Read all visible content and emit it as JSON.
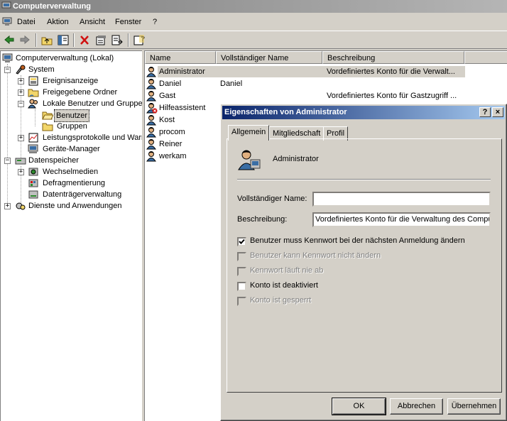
{
  "window": {
    "title": "Computerverwaltung"
  },
  "menu": [
    "Datei",
    "Aktion",
    "Ansicht",
    "Fenster",
    "?"
  ],
  "toolbar_icons": [
    "back-arrow-icon",
    "forward-arrow-icon",
    "up-folder-icon",
    "show-hide-tree-icon",
    "delete-icon",
    "properties-icon",
    "export-list-icon",
    "help-icon"
  ],
  "tree": {
    "root": "Computerverwaltung (Lokal)",
    "system": "System",
    "ereignisanzeige": "Ereignisanzeige",
    "freigegebene_ordner": "Freigegebene Ordner",
    "lokale_benutzer": "Lokale Benutzer und Gruppen",
    "benutzer": "Benutzer",
    "gruppen": "Gruppen",
    "leistungsprotokolle": "Leistungsprotokolle und Warnungen",
    "geraete_manager": "Geräte-Manager",
    "datenspeicher": "Datenspeicher",
    "wechselmedien": "Wechselmedien",
    "defragmentierung": "Defragmentierung",
    "datentraegerverwaltung": "Datenträgerverwaltung",
    "dienste": "Dienste und Anwendungen"
  },
  "list": {
    "columns": [
      "Name",
      "Vollständiger Name",
      "Beschreibung"
    ],
    "rows": [
      {
        "name": "Administrator",
        "full_name": "",
        "description": "Vordefiniertes Konto für die Verwalt..."
      },
      {
        "name": "Daniel",
        "full_name": "Daniel",
        "description": ""
      },
      {
        "name": "Gast",
        "full_name": "",
        "description": "Vordefiniertes Konto für Gastzugriff ..."
      },
      {
        "name": "Hilfeassistent",
        "full_name": "",
        "description": ""
      },
      {
        "name": "Kost",
        "full_name": "",
        "description": ""
      },
      {
        "name": "procom",
        "full_name": "",
        "description": ""
      },
      {
        "name": "Reiner",
        "full_name": "",
        "description": ""
      },
      {
        "name": "werkam",
        "full_name": "",
        "description": ""
      }
    ]
  },
  "dialog": {
    "title": "Eigenschaften von Administrator",
    "help_btn": "?",
    "close_btn": "×",
    "tabs": [
      "Allgemein",
      "Mitgliedschaft",
      "Profil"
    ],
    "user_name": "Administrator",
    "full_name_label": "Vollständiger Name:",
    "full_name_value": "",
    "description_label": "Beschreibung:",
    "description_value": "Vordefiniertes Konto für die Verwaltung des Comput",
    "checkboxes": [
      {
        "label": "Benutzer muss Kennwort bei der nächsten Anmeldung ändern",
        "checked": true,
        "enabled": true
      },
      {
        "label": "Benutzer kann Kennwort nicht ändern",
        "checked": false,
        "enabled": false
      },
      {
        "label": "Kennwort läuft nie ab",
        "checked": false,
        "enabled": false
      },
      {
        "label": "Konto ist deaktiviert",
        "checked": false,
        "enabled": true
      },
      {
        "label": "Konto ist gesperrt",
        "checked": false,
        "enabled": false
      }
    ],
    "buttons": {
      "ok": "OK",
      "cancel": "Abbrechen",
      "apply": "Übernehmen"
    }
  }
}
